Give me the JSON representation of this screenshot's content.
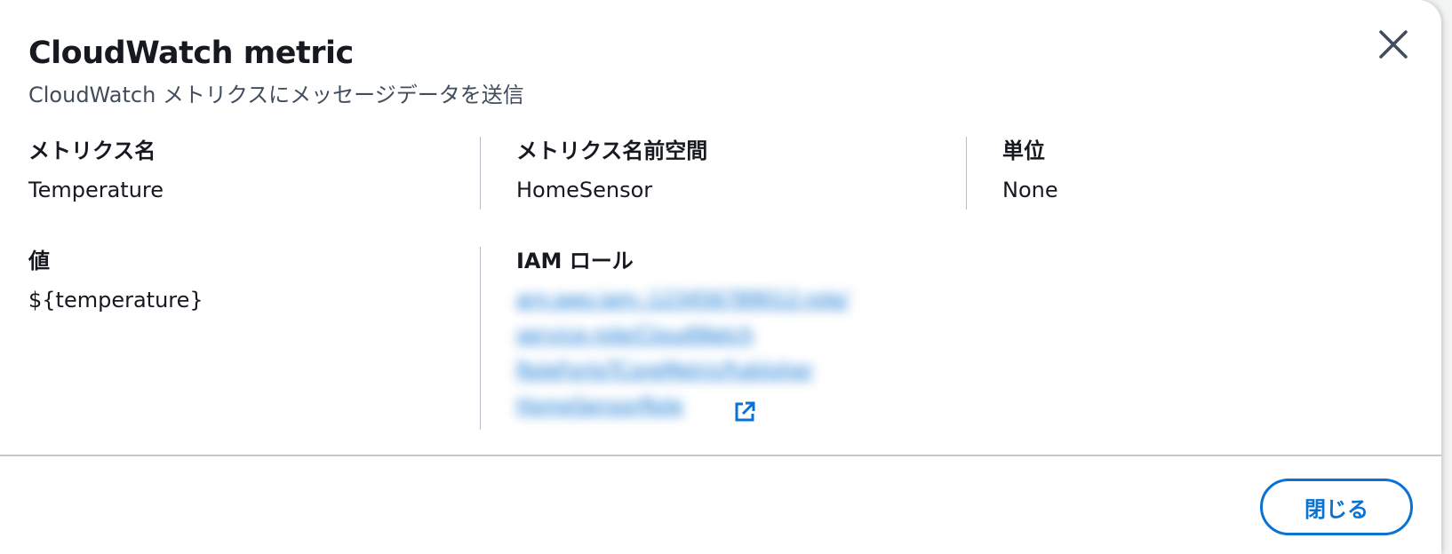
{
  "modal": {
    "title": "CloudWatch metric",
    "subtitle": "CloudWatch メトリクスにメッセージデータを送信",
    "close_icon": "close-icon"
  },
  "fields": {
    "metric_name": {
      "label": "メトリクス名",
      "value": "Temperature"
    },
    "metric_namespace": {
      "label": "メトリクス名前空間",
      "value": "HomeSensor"
    },
    "unit": {
      "label": "単位",
      "value": "None"
    },
    "value": {
      "label": "値",
      "value": "${temperature}"
    },
    "iam_role": {
      "label": "IAM ロール",
      "link_lines": [
        "arn:aws:iam::123456789012:role/",
        "service-role/CloudWatch",
        "RoleForIoTCoreMetricPublisher",
        "HomeSensorRole"
      ],
      "link_icon": "external-link-icon"
    }
  },
  "footer": {
    "close_label": "閉じる"
  },
  "colors": {
    "accent": "#0972d3",
    "text": "#16191f",
    "subtext": "#414d5c",
    "divider": "#b6bec9"
  }
}
